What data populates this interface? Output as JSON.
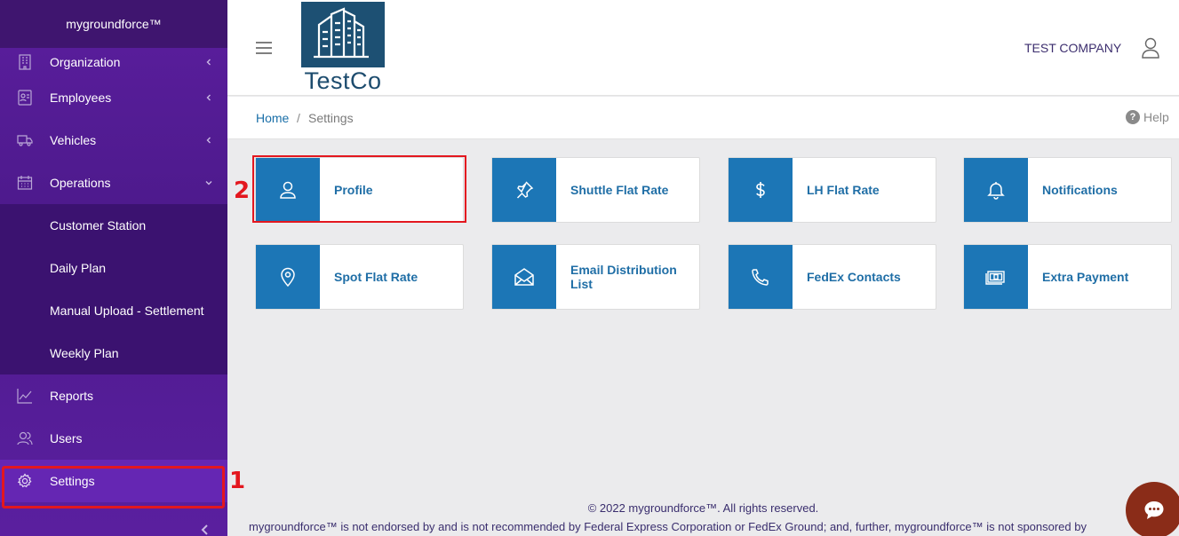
{
  "sidebar": {
    "brand": "mygroundforce™",
    "items": [
      {
        "label": "Organization",
        "icon": "building-icon"
      },
      {
        "label": "Employees",
        "icon": "id-badge-icon"
      },
      {
        "label": "Vehicles",
        "icon": "truck-icon"
      },
      {
        "label": "Operations",
        "icon": "calendar-icon"
      }
    ],
    "operations_sub": [
      "Customer Station",
      "Daily Plan",
      "Manual Upload - Settlement",
      "Weekly Plan"
    ],
    "bottom_items": [
      {
        "label": "Reports",
        "icon": "chart-line-icon"
      },
      {
        "label": "Users",
        "icon": "users-icon"
      },
      {
        "label": "Settings",
        "icon": "gear-icon"
      }
    ]
  },
  "header": {
    "logo_text": "TestCo",
    "company": "TEST COMPANY"
  },
  "breadcrumb": {
    "home": "Home",
    "separator": "/",
    "current": "Settings",
    "help": "Help"
  },
  "cards": [
    {
      "label": "Profile",
      "icon": "user-icon"
    },
    {
      "label": "Shuttle Flat Rate",
      "icon": "pushpin-icon"
    },
    {
      "label": "LH Flat Rate",
      "icon": "dollar-icon"
    },
    {
      "label": "Notifications",
      "icon": "bell-icon"
    },
    {
      "label": "Spot Flat Rate",
      "icon": "map-pin-icon"
    },
    {
      "label": "Email Distribution List",
      "icon": "envelope-icon"
    },
    {
      "label": "FedEx Contacts",
      "icon": "phone-icon"
    },
    {
      "label": "Extra Payment",
      "icon": "money-bill-icon"
    }
  ],
  "annotations": {
    "mark1": "1",
    "mark2": "2"
  },
  "footer": {
    "copyright": "© 2022 mygroundforce™. All rights reserved.",
    "disclaimer": "mygroundforce™ is not endorsed by and is not recommended by Federal Express Corporation or FedEx Ground; and, further, mygroundforce™ is not sponsored by"
  },
  "colors": {
    "sidebar": "#5b1e9e",
    "tile": "#1c76b6",
    "highlight": "#e3171f"
  }
}
